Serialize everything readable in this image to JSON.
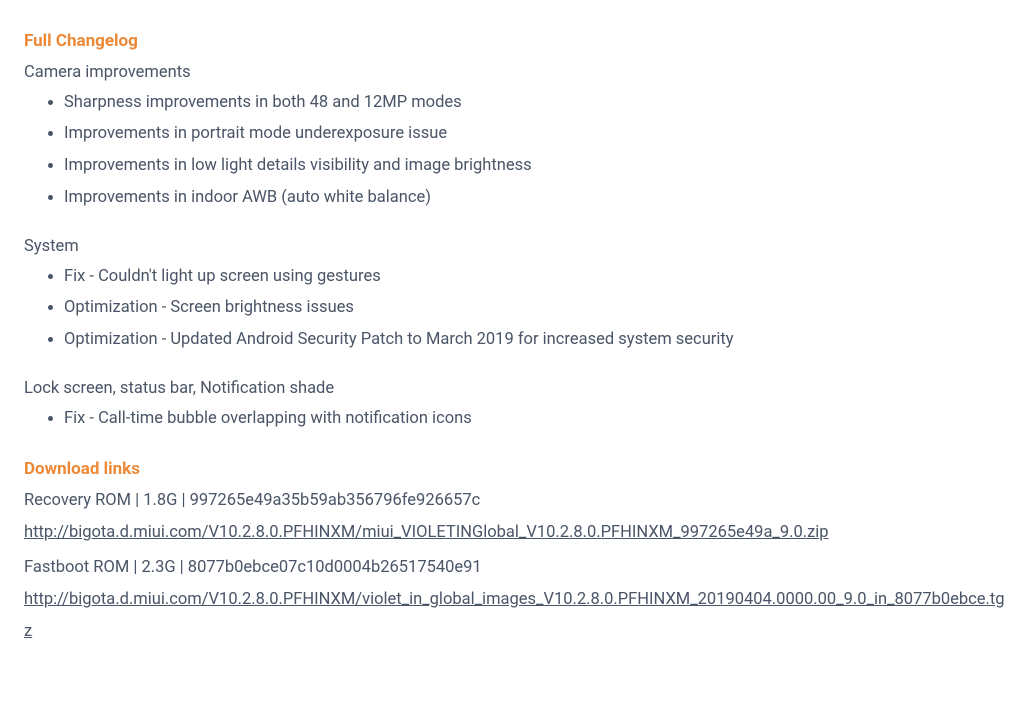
{
  "changelog": {
    "title": "Full Changelog",
    "sections": [
      {
        "heading": "Camera improvements",
        "items": [
          "Sharpness improvements in both 48 and 12MP modes",
          "Improvements in portrait mode underexposure issue",
          "Improvements in low light details visibility and image brightness",
          "Improvements in indoor AWB (auto white balance)"
        ]
      },
      {
        "heading": "System",
        "items": [
          "Fix - Couldn't light up screen using gestures",
          "Optimization - Screen brightness issues",
          "Optimization - Updated Android Security Patch to March 2019 for increased system security"
        ]
      },
      {
        "heading": "Lock screen, status bar, Notification shade",
        "items": [
          "Fix - Call-time bubble overlapping with notification icons"
        ]
      }
    ]
  },
  "downloads": {
    "title": "Download links",
    "recovery_label": "Recovery ROM | 1.8G | 997265e49a35b59ab356796fe926657c",
    "recovery_url": "http://bigota.d.miui.com/V10.2.8.0.PFHINXM/miui_VIOLETINGlobal_V10.2.8.0.PFHINXM_997265e49a_9.0.zip",
    "fastboot_label": "Fastboot ROM | 2.3G | 8077b0ebce07c10d0004b26517540e91",
    "fastboot_url": "http://bigota.d.miui.com/V10.2.8.0.PFHINXM/violet_in_global_images_V10.2.8.0.PFHINXM_20190404.0000.00_9.0_in_8077b0ebce.tgz"
  }
}
